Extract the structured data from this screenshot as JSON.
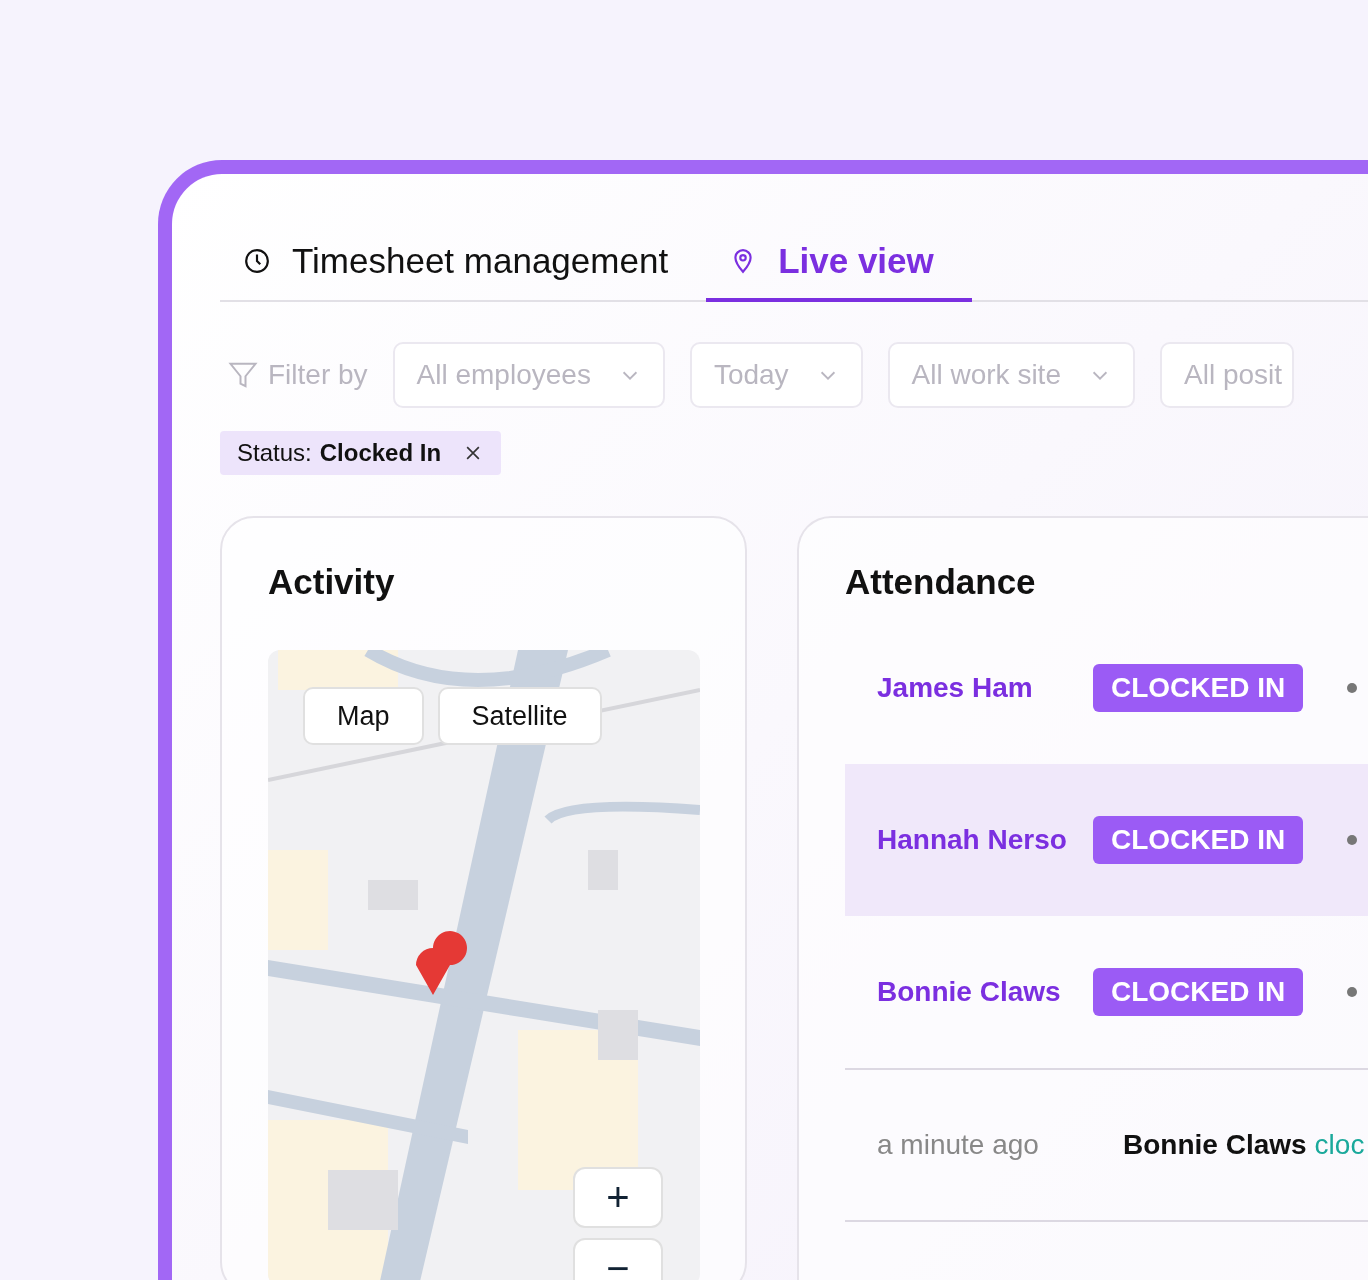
{
  "tabs": [
    {
      "label": "Timesheet management",
      "selected": false
    },
    {
      "label": "Live view",
      "selected": true
    }
  ],
  "filters": {
    "label": "Filter by",
    "dropdowns": [
      "All employees",
      "Today",
      "All work site",
      "All posit"
    ]
  },
  "active_filters": [
    {
      "key": "Status:",
      "value": "Clocked In"
    }
  ],
  "activity": {
    "title": "Activity",
    "map_buttons": [
      {
        "label": "Map"
      },
      {
        "label": "Satellite"
      }
    ],
    "zoom": [
      "+",
      "−"
    ]
  },
  "attendance": {
    "title": "Attendance",
    "rows": [
      {
        "name": "James Ham",
        "status": "CLOCKED IN",
        "selected": false
      },
      {
        "name": "Hannah Nerso",
        "status": "CLOCKED IN",
        "selected": true
      },
      {
        "name": "Bonnie Claws",
        "status": "CLOCKED IN",
        "selected": false
      }
    ],
    "events": [
      {
        "time": "a minute ago",
        "name": "Bonnie Claws",
        "action": "cloc"
      }
    ]
  }
}
